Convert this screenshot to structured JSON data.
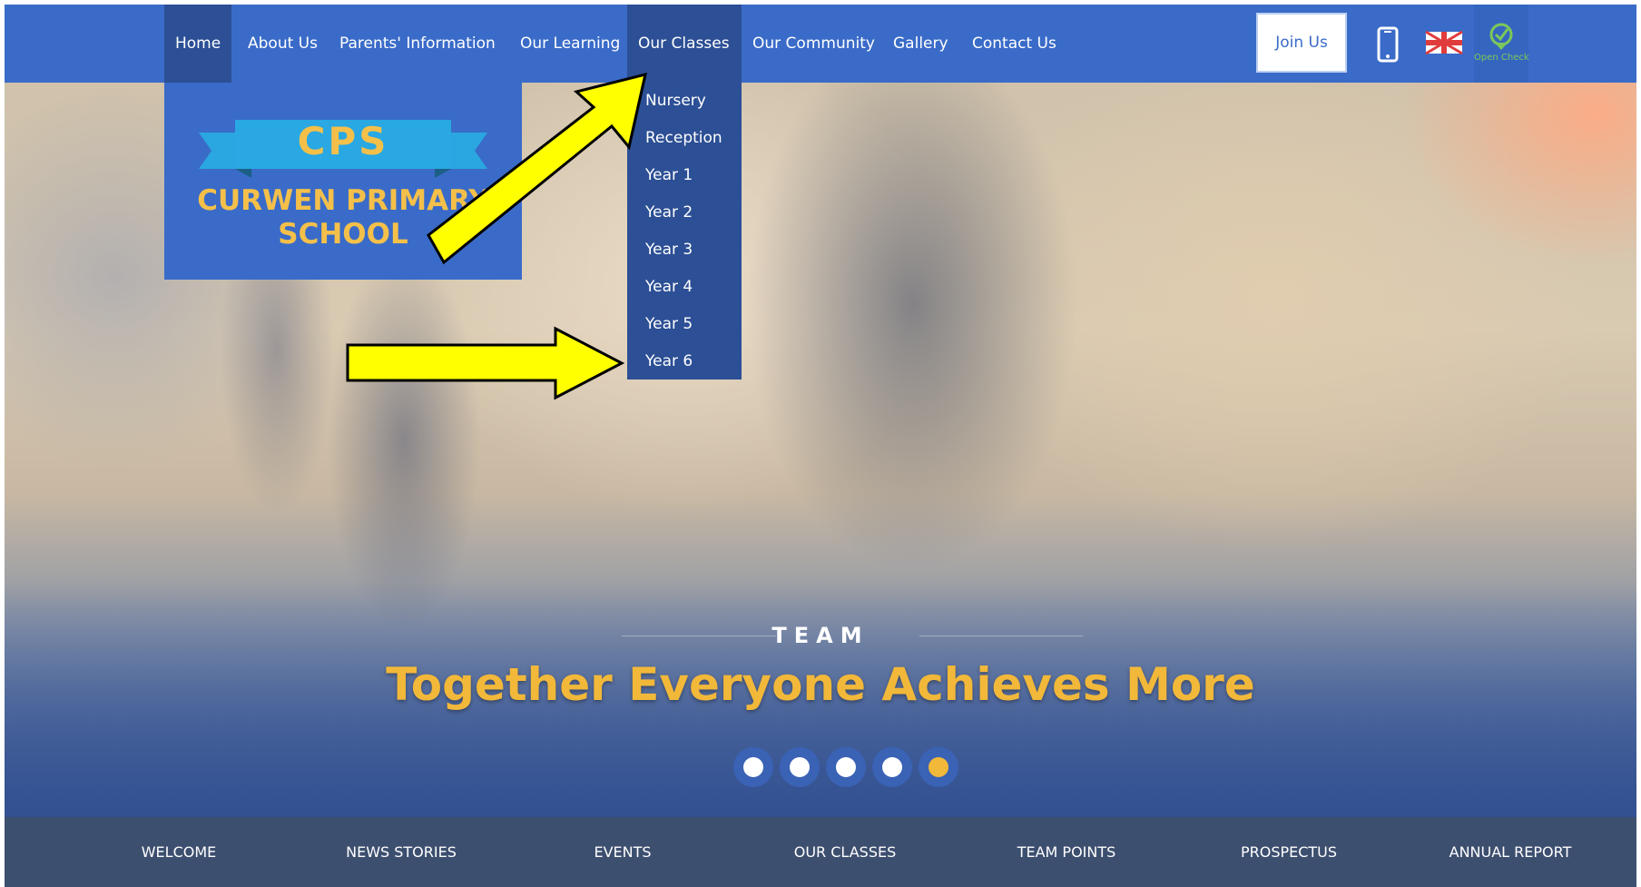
{
  "topnav": {
    "items": [
      {
        "label": "Home"
      },
      {
        "label": "About Us"
      },
      {
        "label": "Parents' Information"
      },
      {
        "label": "Our Learning"
      },
      {
        "label": "Our Classes"
      },
      {
        "label": "Our Community"
      },
      {
        "label": "Gallery"
      },
      {
        "label": "Contact Us"
      }
    ],
    "join_label": "Join Us",
    "open_check_label": "Open Check"
  },
  "dropdown": {
    "items": [
      {
        "label": "Nursery"
      },
      {
        "label": "Reception"
      },
      {
        "label": "Year 1"
      },
      {
        "label": "Year 2"
      },
      {
        "label": "Year 3"
      },
      {
        "label": "Year 4"
      },
      {
        "label": "Year 5"
      },
      {
        "label": "Year 6"
      }
    ]
  },
  "logo": {
    "acronym": "CPS",
    "line1": "CURWEN PRIMARY",
    "line2": "SCHOOL"
  },
  "hero": {
    "kicker": "TEAM",
    "slogan": "Together Everyone Achieves More",
    "slide_count": 5,
    "active_slide": 5
  },
  "bottomnav": {
    "items": [
      {
        "label": "WELCOME"
      },
      {
        "label": "NEWS STORIES"
      },
      {
        "label": "EVENTS"
      },
      {
        "label": "OUR CLASSES"
      },
      {
        "label": "TEAM POINTS"
      },
      {
        "label": "PROSPECTUS"
      },
      {
        "label": "ANNUAL REPORT"
      }
    ]
  },
  "colors": {
    "nav_blue": "#3a6bc8",
    "nav_active": "#2c4f95",
    "accent_gold": "#f2b83a",
    "bottom_bar": "#3d4f6f",
    "annotation_arrow": "#ffff00"
  }
}
